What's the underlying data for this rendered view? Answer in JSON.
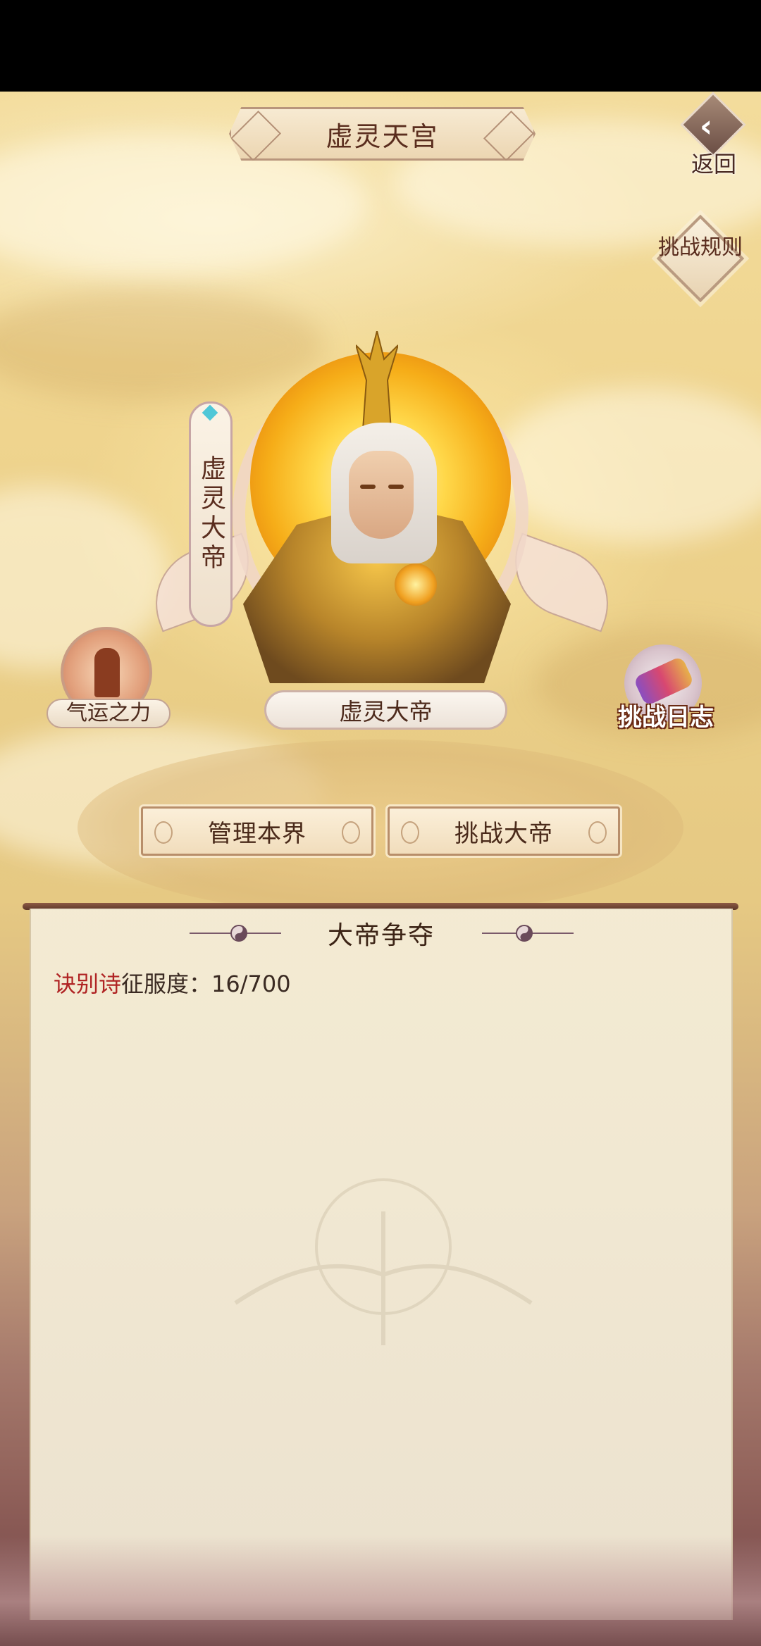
{
  "header": {
    "title": "虚灵天宫",
    "back_label": "返回",
    "rules_label": "挑战规则"
  },
  "emperor": {
    "banner_title": "虚灵大帝",
    "name": "虚灵大帝"
  },
  "side_buttons": {
    "fortune": "气运之力",
    "challenge_log": "挑战日志"
  },
  "actions": {
    "manage": "管理本界",
    "challenge": "挑战大帝"
  },
  "panel": {
    "title": "大帝争夺",
    "player_name": "诀别诗",
    "conquest_label": "征服度：",
    "conquest_value": "16/700"
  }
}
